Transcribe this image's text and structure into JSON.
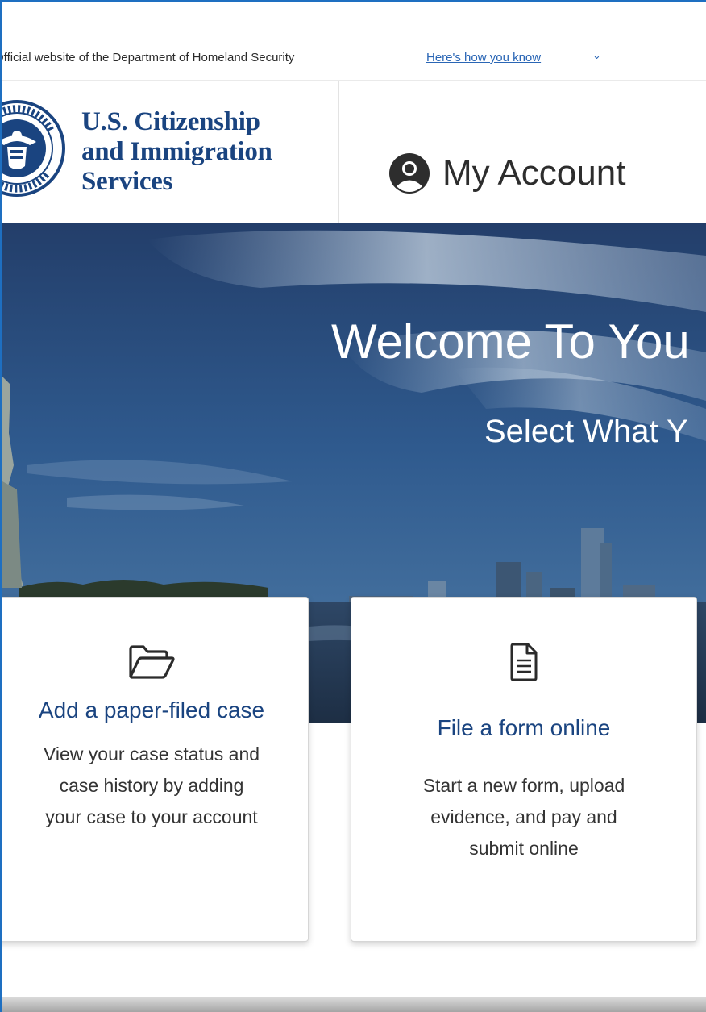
{
  "gov_banner": {
    "text": "Official website of the Department of Homeland Security",
    "link": "Here's how you know"
  },
  "header": {
    "agency_line1": "U.S. Citizenship",
    "agency_line2": "and Immigration",
    "agency_line3": "Services",
    "account_label": "My Account"
  },
  "hero": {
    "title": "Welcome To You",
    "subtitle": "Select What Y"
  },
  "cards": [
    {
      "icon": "folder-open-icon",
      "title": "Add a paper-filed case",
      "desc_line1": "View your case status and",
      "desc_line2": "case history by adding",
      "desc_line3": "your case to your account"
    },
    {
      "icon": "document-icon",
      "title": "File a form online",
      "desc_line1": "Start a new form, upload",
      "desc_line2": "evidence, and pay and",
      "desc_line3": "submit online"
    }
  ],
  "colors": {
    "brand_navy": "#1a4480",
    "link_blue": "#2a66b5",
    "frame_blue": "#1e6fc1"
  }
}
